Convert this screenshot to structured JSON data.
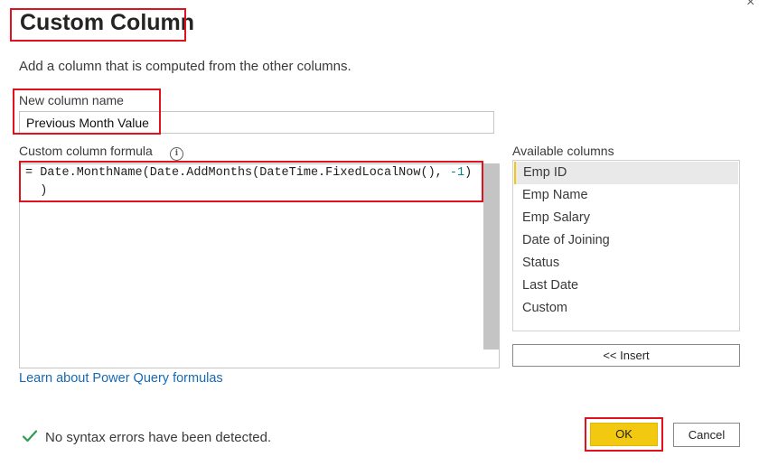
{
  "dialog": {
    "close_glyph": "×",
    "title": "Custom Column",
    "subtitle": "Add a column that is computed from the other columns."
  },
  "new_column": {
    "label": "New column name",
    "value": "Previous Month Value"
  },
  "formula": {
    "label": "Custom column formula",
    "info_glyph": "i",
    "line1_prefix": "= Date.MonthName(Date.AddMonths(DateTime.FixedLocalNow(), ",
    "line1_number": "-1",
    "line1_suffix": ")",
    "line2": "  )"
  },
  "available_columns": {
    "label": "Available columns",
    "items": [
      "Emp ID",
      "Emp Name",
      "Emp Salary",
      "Date of Joining",
      "Status",
      "Last Date",
      "Custom"
    ],
    "selected_index": 0
  },
  "insert_button": {
    "label": "<< Insert"
  },
  "learn_link": {
    "label": "Learn about Power Query formulas"
  },
  "status": {
    "icon": "check-icon",
    "text": "No syntax errors have been detected."
  },
  "buttons": {
    "ok": "OK",
    "cancel": "Cancel"
  },
  "colors": {
    "accent_yellow": "#f2c811",
    "highlight_red": "#e0121d",
    "link_blue": "#1769b4",
    "success_green": "#2e9d4c"
  }
}
